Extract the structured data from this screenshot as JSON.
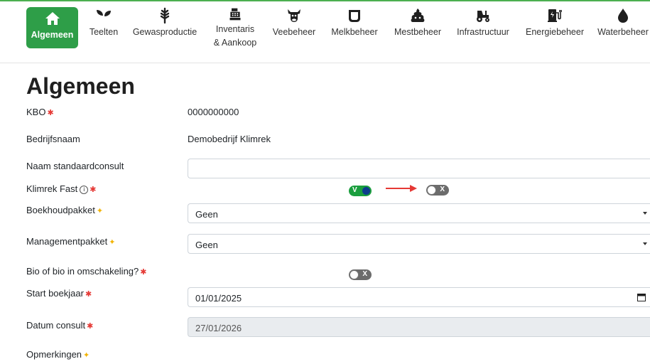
{
  "nav": {
    "items": [
      {
        "label": "Algemeen",
        "icon": "home-icon"
      },
      {
        "label": "Teelten",
        "icon": "seedling-icon"
      },
      {
        "label": "Gewasproductie",
        "icon": "wheat-icon"
      },
      {
        "label": "Inventaris",
        "label2": "& Aankoop",
        "icon": "cash-register-icon"
      },
      {
        "label": "Veebeheer",
        "icon": "cow-icon"
      },
      {
        "label": "Melkbeheer",
        "icon": "milk-tank-icon"
      },
      {
        "label": "Mestbeheer",
        "icon": "manure-icon"
      },
      {
        "label": "Infrastructuur",
        "icon": "tractor-icon"
      },
      {
        "label": "Energiebeheer",
        "icon": "charging-station-icon"
      },
      {
        "label": "Waterbeheer",
        "icon": "water-drop-icon"
      }
    ]
  },
  "page": {
    "title": "Algemeen"
  },
  "form": {
    "kbo": {
      "label": "KBO",
      "value": "0000000000"
    },
    "bedrijfsnaam": {
      "label": "Bedrijfsnaam",
      "value": "Demobedrijf Klimrek"
    },
    "naam_standaardconsult": {
      "label": "Naam standaardconsult",
      "value": ""
    },
    "klimrek_fast": {
      "label": "Klimrek Fast",
      "toggle_on_label": "V",
      "toggle_off_label": "X"
    },
    "boekhoudpakket": {
      "label": "Boekhoudpakket",
      "value": "Geen"
    },
    "managementpakket": {
      "label": "Managementpakket",
      "value": "Geen"
    },
    "bio": {
      "label": "Bio of bio in omschakeling?",
      "toggle_off_label": "X"
    },
    "start_boekjaar": {
      "label": "Start boekjaar",
      "value": "01/01/2025"
    },
    "datum_consult": {
      "label": "Datum consult",
      "value": "27/01/2026"
    },
    "opmerkingen": {
      "label": "Opmerkingen"
    }
  },
  "markers": {
    "required": "✱",
    "optional": "✦",
    "info": "i"
  },
  "colors": {
    "accent": "#2e9e48",
    "required": "#e53935",
    "optional": "#f2b300",
    "arrow": "#e53935"
  }
}
